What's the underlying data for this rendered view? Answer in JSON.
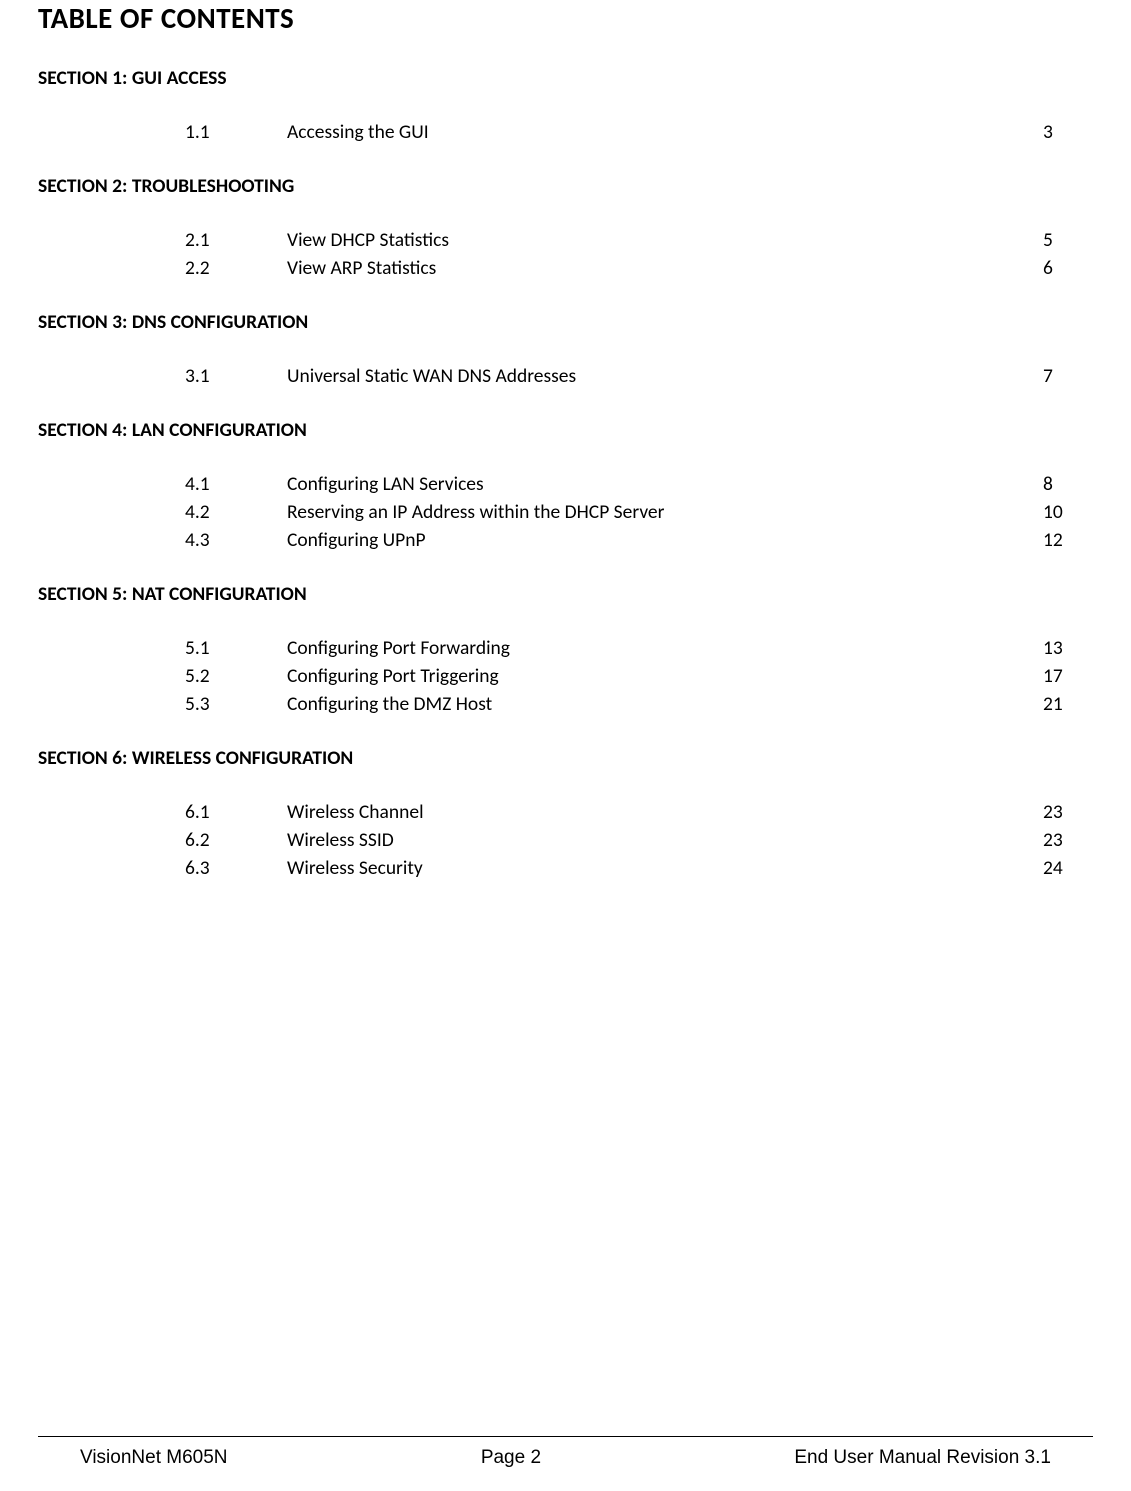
{
  "title": "TABLE OF CONTENTS",
  "sections": [
    {
      "header": "SECTION 1: GUI ACCESS",
      "entries": [
        {
          "num": "1.1",
          "title": "Accessing the GUI",
          "page": "3"
        }
      ]
    },
    {
      "header": "SECTION 2: TROUBLESHOOTING",
      "entries": [
        {
          "num": "2.1",
          "title": "View DHCP Statistics",
          "page": "5"
        },
        {
          "num": "2.2",
          "title": "View ARP Statistics",
          "page": "6"
        }
      ]
    },
    {
      "header": "SECTION 3: DNS CONFIGURATION",
      "entries": [
        {
          "num": "3.1",
          "title": "Universal Static WAN DNS Addresses",
          "page": "7"
        }
      ]
    },
    {
      "header": "SECTION 4: LAN CONFIGURATION",
      "entries": [
        {
          "num": "4.1",
          "title": "Configuring LAN Services",
          "page": "8"
        },
        {
          "num": "4.2",
          "title": "Reserving an IP Address within the DHCP Server",
          "page": "10"
        },
        {
          "num": "4.3",
          "title": "Configuring UPnP",
          "page": "12"
        }
      ]
    },
    {
      "header": "SECTION 5: NAT CONFIGURATION",
      "entries": [
        {
          "num": "5.1",
          "title": "Configuring Port Forwarding",
          "page": "13"
        },
        {
          "num": "5.2",
          "title": "Configuring Port Triggering",
          "page": "17"
        },
        {
          "num": "5.3",
          "title": "Configuring the DMZ Host",
          "page": "21"
        }
      ]
    },
    {
      "header": "SECTION 6: WIRELESS CONFIGURATION",
      "entries": [
        {
          "num": "6.1",
          "title": "Wireless Channel",
          "page": "23"
        },
        {
          "num": "6.2",
          "title": "Wireless SSID",
          "page": "23"
        },
        {
          "num": "6.3",
          "title": "Wireless Security",
          "page": "24"
        }
      ]
    }
  ],
  "footer": {
    "left": "VisionNet M605N",
    "center": "Page 2",
    "right": "End User Manual Revision 3.1"
  }
}
